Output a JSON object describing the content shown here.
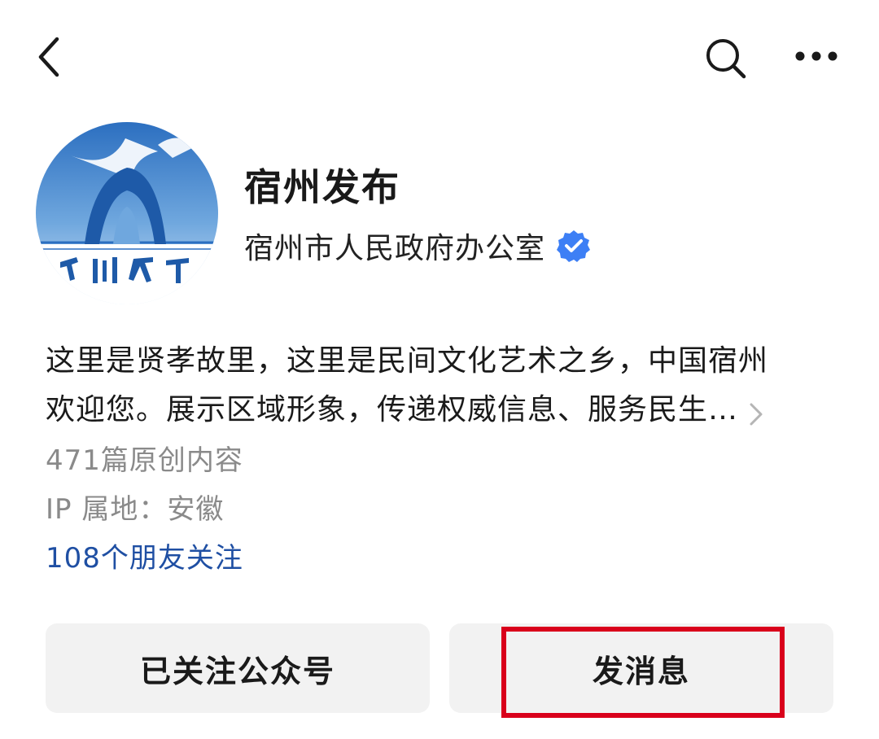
{
  "topbar": {
    "back_icon": "chevron-left-icon",
    "search_icon": "search-icon",
    "more_icon": "more-horizontal-icon"
  },
  "profile": {
    "avatar_text": "宿州发布",
    "name": "宿州发布",
    "organization": "宿州市人民政府办公室",
    "verified_icon": "verified-badge-icon",
    "verified_color": "#3d7ff5"
  },
  "description": {
    "line1": "这里是贤孝故里，这里是民间文化艺术之乡，中国宿州",
    "line2": "欢迎您。展示区域形象，传递权威信息、服务民生…"
  },
  "stats": {
    "original_count": "471篇原创内容",
    "ip_location": "IP 属地：安徽",
    "friends_follow": "108个朋友关注"
  },
  "actions": {
    "follow_label": "已关注公众号",
    "message_label": "发消息"
  },
  "colors": {
    "link": "#1f4fa3",
    "highlight": "#d9001b",
    "button_bg": "#f2f2f2"
  }
}
